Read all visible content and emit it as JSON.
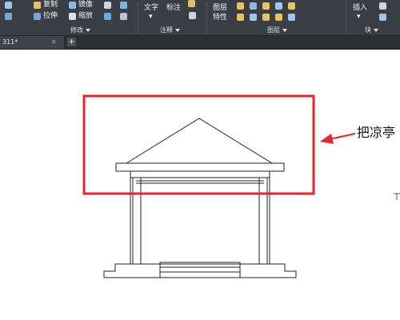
{
  "ribbon": {
    "modify": {
      "title": "修改",
      "copy": "复制",
      "mirror": "镜像",
      "stretch": "拉伸",
      "scale": "缩放"
    },
    "annotation": {
      "title": "注释",
      "text": "文字",
      "dimension": "标注"
    },
    "layers": {
      "title": "图层",
      "layer_properties_line1": "图层",
      "layer_properties_line2": "特性"
    },
    "block": {
      "title": "块",
      "insert": "插入"
    }
  },
  "doc_tab": {
    "label": "311*",
    "close": "✕",
    "new_tab": "+"
  },
  "annotation_text": "把凉亭",
  "colors": {
    "ribbon_bg": "#3a3f45",
    "highlight_box": "#e8262a",
    "arrow": "#e8262a"
  }
}
